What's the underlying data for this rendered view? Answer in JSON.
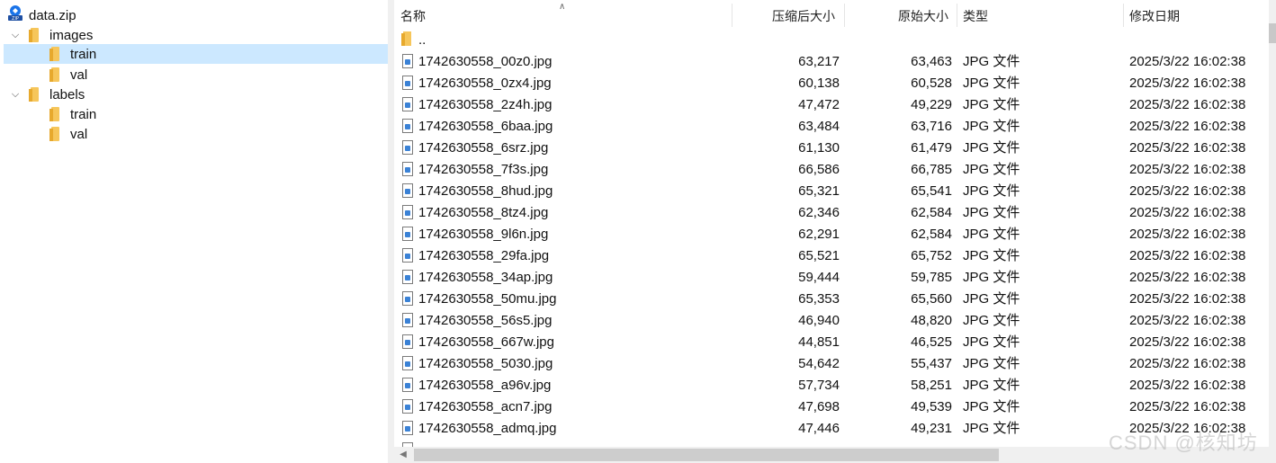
{
  "tree": {
    "root": {
      "label": "data.zip",
      "icon": "zip-archive-icon"
    },
    "nodes": [
      {
        "label": "images",
        "expanded": true
      },
      {
        "label": "train",
        "selected": true
      },
      {
        "label": "val"
      },
      {
        "label": "labels",
        "expanded": true
      },
      {
        "label": "train"
      },
      {
        "label": "val"
      }
    ]
  },
  "columns": {
    "name": "名称",
    "compressed": "压缩后大小",
    "original": "原始大小",
    "type": "类型",
    "modified": "修改日期"
  },
  "parent_row": {
    "label": ".."
  },
  "files": [
    {
      "name": "1742630558_00z0.jpg",
      "compressed": "63,217",
      "original": "63,463",
      "type": "JPG 文件",
      "modified": "2025/3/22 16:02:38"
    },
    {
      "name": "1742630558_0zx4.jpg",
      "compressed": "60,138",
      "original": "60,528",
      "type": "JPG 文件",
      "modified": "2025/3/22 16:02:38"
    },
    {
      "name": "1742630558_2z4h.jpg",
      "compressed": "47,472",
      "original": "49,229",
      "type": "JPG 文件",
      "modified": "2025/3/22 16:02:38"
    },
    {
      "name": "1742630558_6baa.jpg",
      "compressed": "63,484",
      "original": "63,716",
      "type": "JPG 文件",
      "modified": "2025/3/22 16:02:38"
    },
    {
      "name": "1742630558_6srz.jpg",
      "compressed": "61,130",
      "original": "61,479",
      "type": "JPG 文件",
      "modified": "2025/3/22 16:02:38"
    },
    {
      "name": "1742630558_7f3s.jpg",
      "compressed": "66,586",
      "original": "66,785",
      "type": "JPG 文件",
      "modified": "2025/3/22 16:02:38"
    },
    {
      "name": "1742630558_8hud.jpg",
      "compressed": "65,321",
      "original": "65,541",
      "type": "JPG 文件",
      "modified": "2025/3/22 16:02:38"
    },
    {
      "name": "1742630558_8tz4.jpg",
      "compressed": "62,346",
      "original": "62,584",
      "type": "JPG 文件",
      "modified": "2025/3/22 16:02:38"
    },
    {
      "name": "1742630558_9l6n.jpg",
      "compressed": "62,291",
      "original": "62,584",
      "type": "JPG 文件",
      "modified": "2025/3/22 16:02:38"
    },
    {
      "name": "1742630558_29fa.jpg",
      "compressed": "65,521",
      "original": "65,752",
      "type": "JPG 文件",
      "modified": "2025/3/22 16:02:38"
    },
    {
      "name": "1742630558_34ap.jpg",
      "compressed": "59,444",
      "original": "59,785",
      "type": "JPG 文件",
      "modified": "2025/3/22 16:02:38"
    },
    {
      "name": "1742630558_50mu.jpg",
      "compressed": "65,353",
      "original": "65,560",
      "type": "JPG 文件",
      "modified": "2025/3/22 16:02:38"
    },
    {
      "name": "1742630558_56s5.jpg",
      "compressed": "46,940",
      "original": "48,820",
      "type": "JPG 文件",
      "modified": "2025/3/22 16:02:38"
    },
    {
      "name": "1742630558_667w.jpg",
      "compressed": "44,851",
      "original": "46,525",
      "type": "JPG 文件",
      "modified": "2025/3/22 16:02:38"
    },
    {
      "name": "1742630558_5030.jpg",
      "compressed": "54,642",
      "original": "55,437",
      "type": "JPG 文件",
      "modified": "2025/3/22 16:02:38"
    },
    {
      "name": "1742630558_a96v.jpg",
      "compressed": "57,734",
      "original": "58,251",
      "type": "JPG 文件",
      "modified": "2025/3/22 16:02:38"
    },
    {
      "name": "1742630558_acn7.jpg",
      "compressed": "47,698",
      "original": "49,539",
      "type": "JPG 文件",
      "modified": "2025/3/22 16:02:38"
    },
    {
      "name": "1742630558_admq.jpg",
      "compressed": "47,446",
      "original": "49,231",
      "type": "JPG 文件",
      "modified": "2025/3/22 16:02:38"
    }
  ],
  "watermark": "CSDN @核知坊",
  "colors": {
    "selection": "#cce8ff",
    "folder": "#f6c65b",
    "file_icon_accent": "#3b82d6"
  }
}
